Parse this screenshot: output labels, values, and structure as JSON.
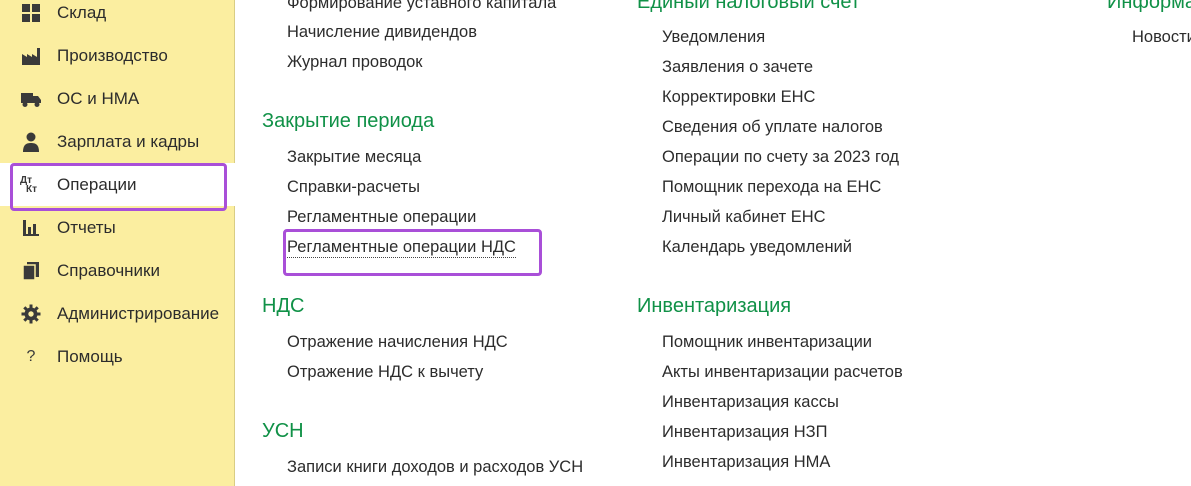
{
  "sidebar": {
    "items": [
      {
        "label": "Склад",
        "icon": "warehouse-icon"
      },
      {
        "label": "Производство",
        "icon": "factory-icon"
      },
      {
        "label": "ОС и НМА",
        "icon": "truck-icon"
      },
      {
        "label": "Зарплата и кадры",
        "icon": "person-icon"
      },
      {
        "label": "Операции",
        "icon": "dt-kt-icon",
        "icon_text_top": "Дт",
        "icon_text_bottom": "Кт",
        "active": true
      },
      {
        "label": "Отчеты",
        "icon": "bar-chart-icon"
      },
      {
        "label": "Справочники",
        "icon": "books-icon"
      },
      {
        "label": "Администрирование",
        "icon": "gear-icon"
      },
      {
        "label": "Помощь",
        "icon": "question-icon",
        "icon_text": "?"
      }
    ]
  },
  "columns": {
    "left": {
      "top_links": [
        "Формирование уставного капитала",
        "Начисление дивидендов",
        "Журнал проводок"
      ],
      "sections": [
        {
          "title": "Закрытие периода",
          "links": [
            "Закрытие месяца",
            "Справки-расчеты",
            "Регламентные операции",
            "Регламентные операции НДС"
          ]
        },
        {
          "title": "НДС",
          "links": [
            "Отражение начисления НДС",
            "Отражение НДС к вычету"
          ]
        },
        {
          "title": "УСН",
          "links": [
            "Записи книги доходов и расходов УСН"
          ]
        }
      ]
    },
    "middle": {
      "sections": [
        {
          "title": "Единый налоговый счет",
          "links": [
            "Уведомления",
            "Заявления о зачете",
            "Корректировки ЕНС",
            "Сведения об уплате налогов",
            "Операции по счету за 2023 год",
            "Помощник перехода на ЕНС",
            "Личный кабинет ЕНС",
            "Календарь уведомлений"
          ]
        },
        {
          "title": "Инвентаризация",
          "links": [
            "Помощник инвентаризации",
            "Акты инвентаризации расчетов",
            "Инвентаризация кассы",
            "Инвентаризация НЗП",
            "Инвентаризация НМА"
          ]
        }
      ]
    },
    "right": {
      "sections": [
        {
          "title": "Информа",
          "links": [
            "Новости"
          ]
        }
      ]
    }
  },
  "colors": {
    "sidebar_bg": "#fbeea0",
    "section_title": "#109147",
    "highlight": "#a94fd8"
  }
}
